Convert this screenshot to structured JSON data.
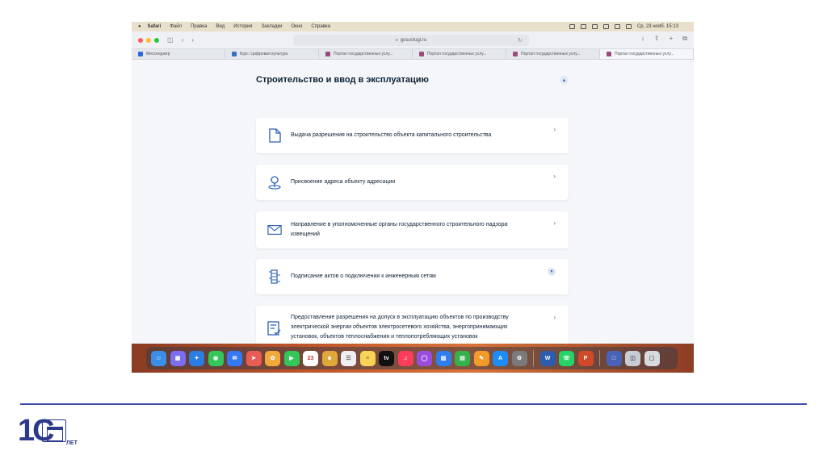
{
  "menubar": {
    "apple": "",
    "app": "Safari",
    "items": [
      "Файл",
      "Правка",
      "Вид",
      "История",
      "Закладки",
      "Окно",
      "Справка"
    ],
    "clock": "Ср, 23 нояб. 15:13"
  },
  "toolbar": {
    "url": "gosuslugi.ru"
  },
  "tabs": [
    {
      "label": "Мессенджер",
      "color": "#2f6bd8"
    },
    {
      "label": "Курс: Цифровая культура",
      "color": "#3a6fc4"
    },
    {
      "label": "Портал государственных услу...",
      "color": "#9b4d7a"
    },
    {
      "label": "Портал государственных услу...",
      "color": "#9b4d7a"
    },
    {
      "label": "Портал государственных услу...",
      "color": "#9b4d7a"
    },
    {
      "label": "Портал государственных услу...",
      "color": "#9b4d7a"
    }
  ],
  "main": {
    "section_title": "Строительство и ввод в эксплуатацию",
    "cards": [
      {
        "text": "Выдача разрешения на строительство объекта капитального строительства",
        "icon": "document-icon"
      },
      {
        "text": "Присвоение адреса объекту адресации",
        "icon": "location-pin-icon"
      },
      {
        "text": "Направление в уполномоченные органы государственного строительного надзора извещений",
        "icon": "envelope-icon"
      },
      {
        "text": "Подписание актов о подключении к инженерным сетям",
        "icon": "network-icon"
      },
      {
        "text": "Предоставление разрешения на допуск в эксплуатацию объектов по производству электрической энергии объектов электросетевого хозяйства, энергопринимающих установок, объектов теплоснабжения и теплопотребляющих установок",
        "icon": "form-check-icon"
      }
    ]
  },
  "dock": {
    "calendar_day": "23",
    "tv_label": "tv"
  },
  "colors": {
    "accent": "#2a5fb5",
    "divider": "#3f4ba3",
    "logo": "#2d3a8c"
  },
  "logo": {
    "brand": "1С",
    "years": "ЛЕТ"
  }
}
